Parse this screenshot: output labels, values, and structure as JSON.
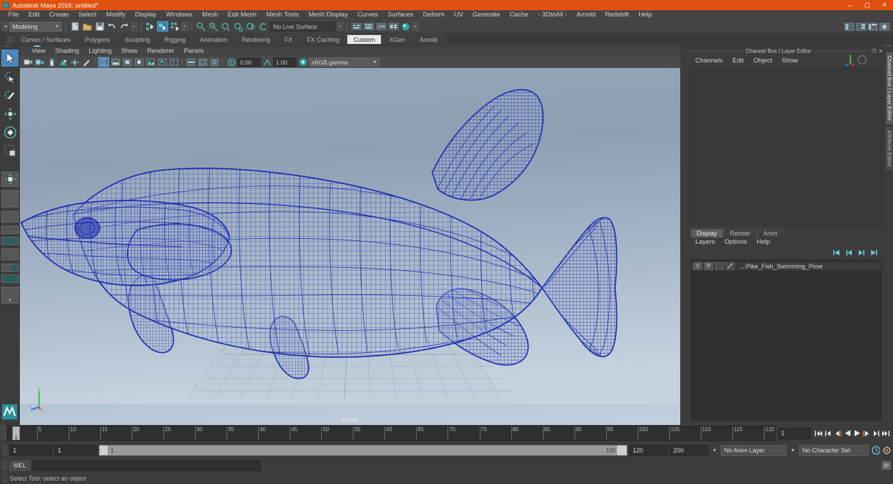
{
  "window": {
    "title": "Autodesk Maya 2016: untitled*",
    "minimize": "–",
    "maximize": "▢",
    "close": "✕"
  },
  "menubar": {
    "items": [
      "File",
      "Edit",
      "Create",
      "Select",
      "Modify",
      "Display",
      "Windows",
      "Mesh",
      "Edit Mesh",
      "Mesh Tools",
      "Mesh Display",
      "Curves",
      "Surfaces",
      "Deform",
      "UV",
      "Generate",
      "Cache",
      "- 3DtoAll -",
      "Arnold",
      "Redshift",
      "Help"
    ]
  },
  "statusline": {
    "menuset": "Modeling",
    "live_surface": "No Live Surface",
    "arrow": "▼"
  },
  "shelf": {
    "tabs": [
      "Curves / Surfaces",
      "Polygons",
      "Sculpting",
      "Rigging",
      "Animation",
      "Rendering",
      "FX",
      "FX Caching",
      "Custom",
      "XGen",
      "Arnold"
    ],
    "active_tab": "Custom",
    "scroll_up": "▲",
    "scroll_down": "▼"
  },
  "viewport": {
    "menus": [
      "View",
      "Shading",
      "Lighting",
      "Show",
      "Renderer",
      "Panels"
    ],
    "exposure": "0.00",
    "gamma": "1.00",
    "color_profile": "sRGB gamma",
    "camera_label": "persp",
    "axis": {
      "x": "x",
      "y": "y",
      "z": "z"
    }
  },
  "channelbox": {
    "title": "Channel Box / Layer Editor",
    "menus": [
      "Channels",
      "Edit",
      "Object",
      "Show"
    ],
    "win_restore": "❐",
    "win_close": "✕"
  },
  "layereditor": {
    "tabs": [
      "Display",
      "Render",
      "Anim"
    ],
    "active_tab": "Display",
    "menus": [
      "Layers",
      "Options",
      "Help"
    ],
    "layers": [
      {
        "visible": "V",
        "playback": "P",
        "color": "",
        "name": "...:Pike_Fish_Swimming_Pose"
      }
    ]
  },
  "side_tabs": {
    "items": [
      "Channel Box / Layer Editor",
      "Attribute Editor"
    ],
    "active": "Channel Box / Layer Editor"
  },
  "timeslider": {
    "current_frame": "1",
    "ticks": [
      "5",
      "10",
      "15",
      "20",
      "25",
      "30",
      "35",
      "40",
      "45",
      "50",
      "55",
      "60",
      "65",
      "70",
      "75",
      "80",
      "85",
      "90",
      "95",
      "100",
      "105",
      "110",
      "115",
      "120"
    ],
    "playhead_label": "1",
    "frame_field": "1"
  },
  "rangeslider": {
    "anim_start": "1",
    "range_start": "1",
    "range_bar_start": "1",
    "range_bar_end": "120",
    "range_end": "120",
    "anim_end": "200",
    "anim_layer": "No Anim Layer",
    "character_set": "No Character Set",
    "arrow": "▼"
  },
  "commandline": {
    "language": "MEL",
    "input_value": "",
    "input_placeholder": ""
  },
  "helpline": {
    "text": "Select Tool: select an object"
  },
  "colors": {
    "accent_orange": "#e0500f",
    "wireframe_blue": "#1f2fb0",
    "selection_blue": "#3d7fb5",
    "panel_bg": "#3c3c3c"
  }
}
